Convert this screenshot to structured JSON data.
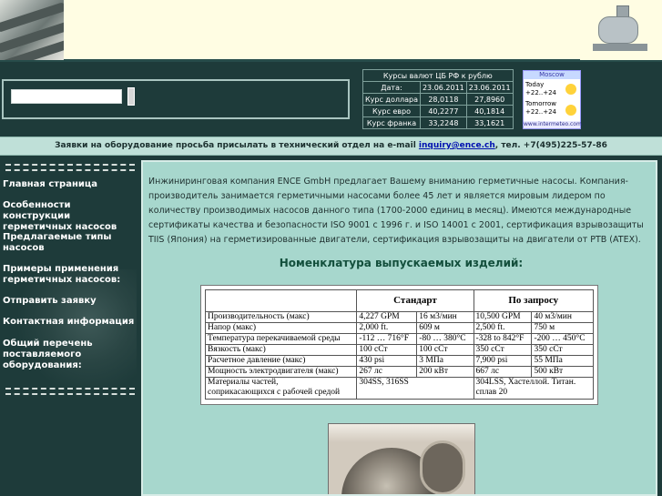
{
  "search": {
    "placeholder": ""
  },
  "rates": {
    "caption": "Курсы валют ЦБ РФ к рублю",
    "date_label": "Дата:",
    "dates": [
      "23.06.2011",
      "23.06.2011"
    ],
    "rows": [
      {
        "label": "Курс доллара",
        "v1": "28,0118",
        "v2": "27,8960"
      },
      {
        "label": "Курс евро",
        "v1": "40,2277",
        "v2": "40,1814"
      },
      {
        "label": "Курс франка",
        "v1": "33,2248",
        "v2": "33,1621"
      }
    ]
  },
  "weather": {
    "city": "Moscow",
    "today_label": "Today",
    "today_temp": "+22..+24",
    "tomorrow_label": "Tomorrow",
    "tomorrow_temp": "+22..+24",
    "site": "www.intermeteo.com"
  },
  "notice": {
    "text_before": "Заявки на оборудование просьба присылать в технический отдел на e-mail ",
    "email": "inquiry@ence.ch",
    "text_after": ", тел. +7(495)225-57-86"
  },
  "sidebar": {
    "items": [
      {
        "label": "Главная страница"
      },
      {
        "label": "Особенности конструкции герметичных насосов"
      },
      {
        "label": "Предлагаемые типы насосов"
      },
      {
        "label": "Примеры применения герметичных насосов:"
      },
      {
        "label": "Отправить заявку"
      },
      {
        "label": "Контактная информация"
      },
      {
        "label": "Общий перечень поставляемого оборудования:"
      }
    ]
  },
  "content": {
    "intro": "Инжиниринговая компания ENCE GmbH предлагает Вашему вниманию герметичные насосы. Компания-производитель занимается герметичными насосами более 45 лет и является мировым лидером по количеству производимых насосов данного типа (1700-2000 единиц в месяц). Имеются международные сертификаты качества и безопасности ISO 9001 с 1996 г. и ISO 14001 с 2001, сертификация взрывозащиты TIIS (Япония) на герметизированные двигатели, сертификация взрывозащиты на двигатели от PTB (ATEX).",
    "nomenclature_title": "Номенклатура выпускаемых изделий:"
  },
  "spec_table": {
    "header": [
      "Стандарт",
      "По запросу"
    ],
    "rows": [
      [
        "Производительность (макс)",
        "4,227 GPM",
        "16 м3/мин",
        "10,500 GPM",
        "40 м3/мин"
      ],
      [
        "Напор (макс)",
        "2,000 ft.",
        "609 м",
        "2,500 ft.",
        "750 м"
      ],
      [
        "Температура перекачиваемой среды",
        "-112 … 716°F",
        "-80 … 380°C",
        "-328 to 842°F",
        "-200 … 450°C"
      ],
      [
        "Вязкость (макс)",
        "100 сСт",
        "100 сСт",
        "350 сСт",
        "350 сСт"
      ],
      [
        "Расчетное давление (макс)",
        "430 psi",
        "3 МПа",
        "7,900 psi",
        "55 МПа"
      ],
      [
        "Мощность электродвигателя (макс)",
        "267 лс",
        "200 кВт",
        "667 лс",
        "500 кВт"
      ]
    ],
    "materials_label_1": "Материалы частей,",
    "materials_label_2": "соприкасающихся с рабочей средой",
    "materials_std": "304SS, 316SS",
    "materials_req_1": "304LSS, Хастеллой. Титан.",
    "materials_req_2": "сплав 20"
  }
}
